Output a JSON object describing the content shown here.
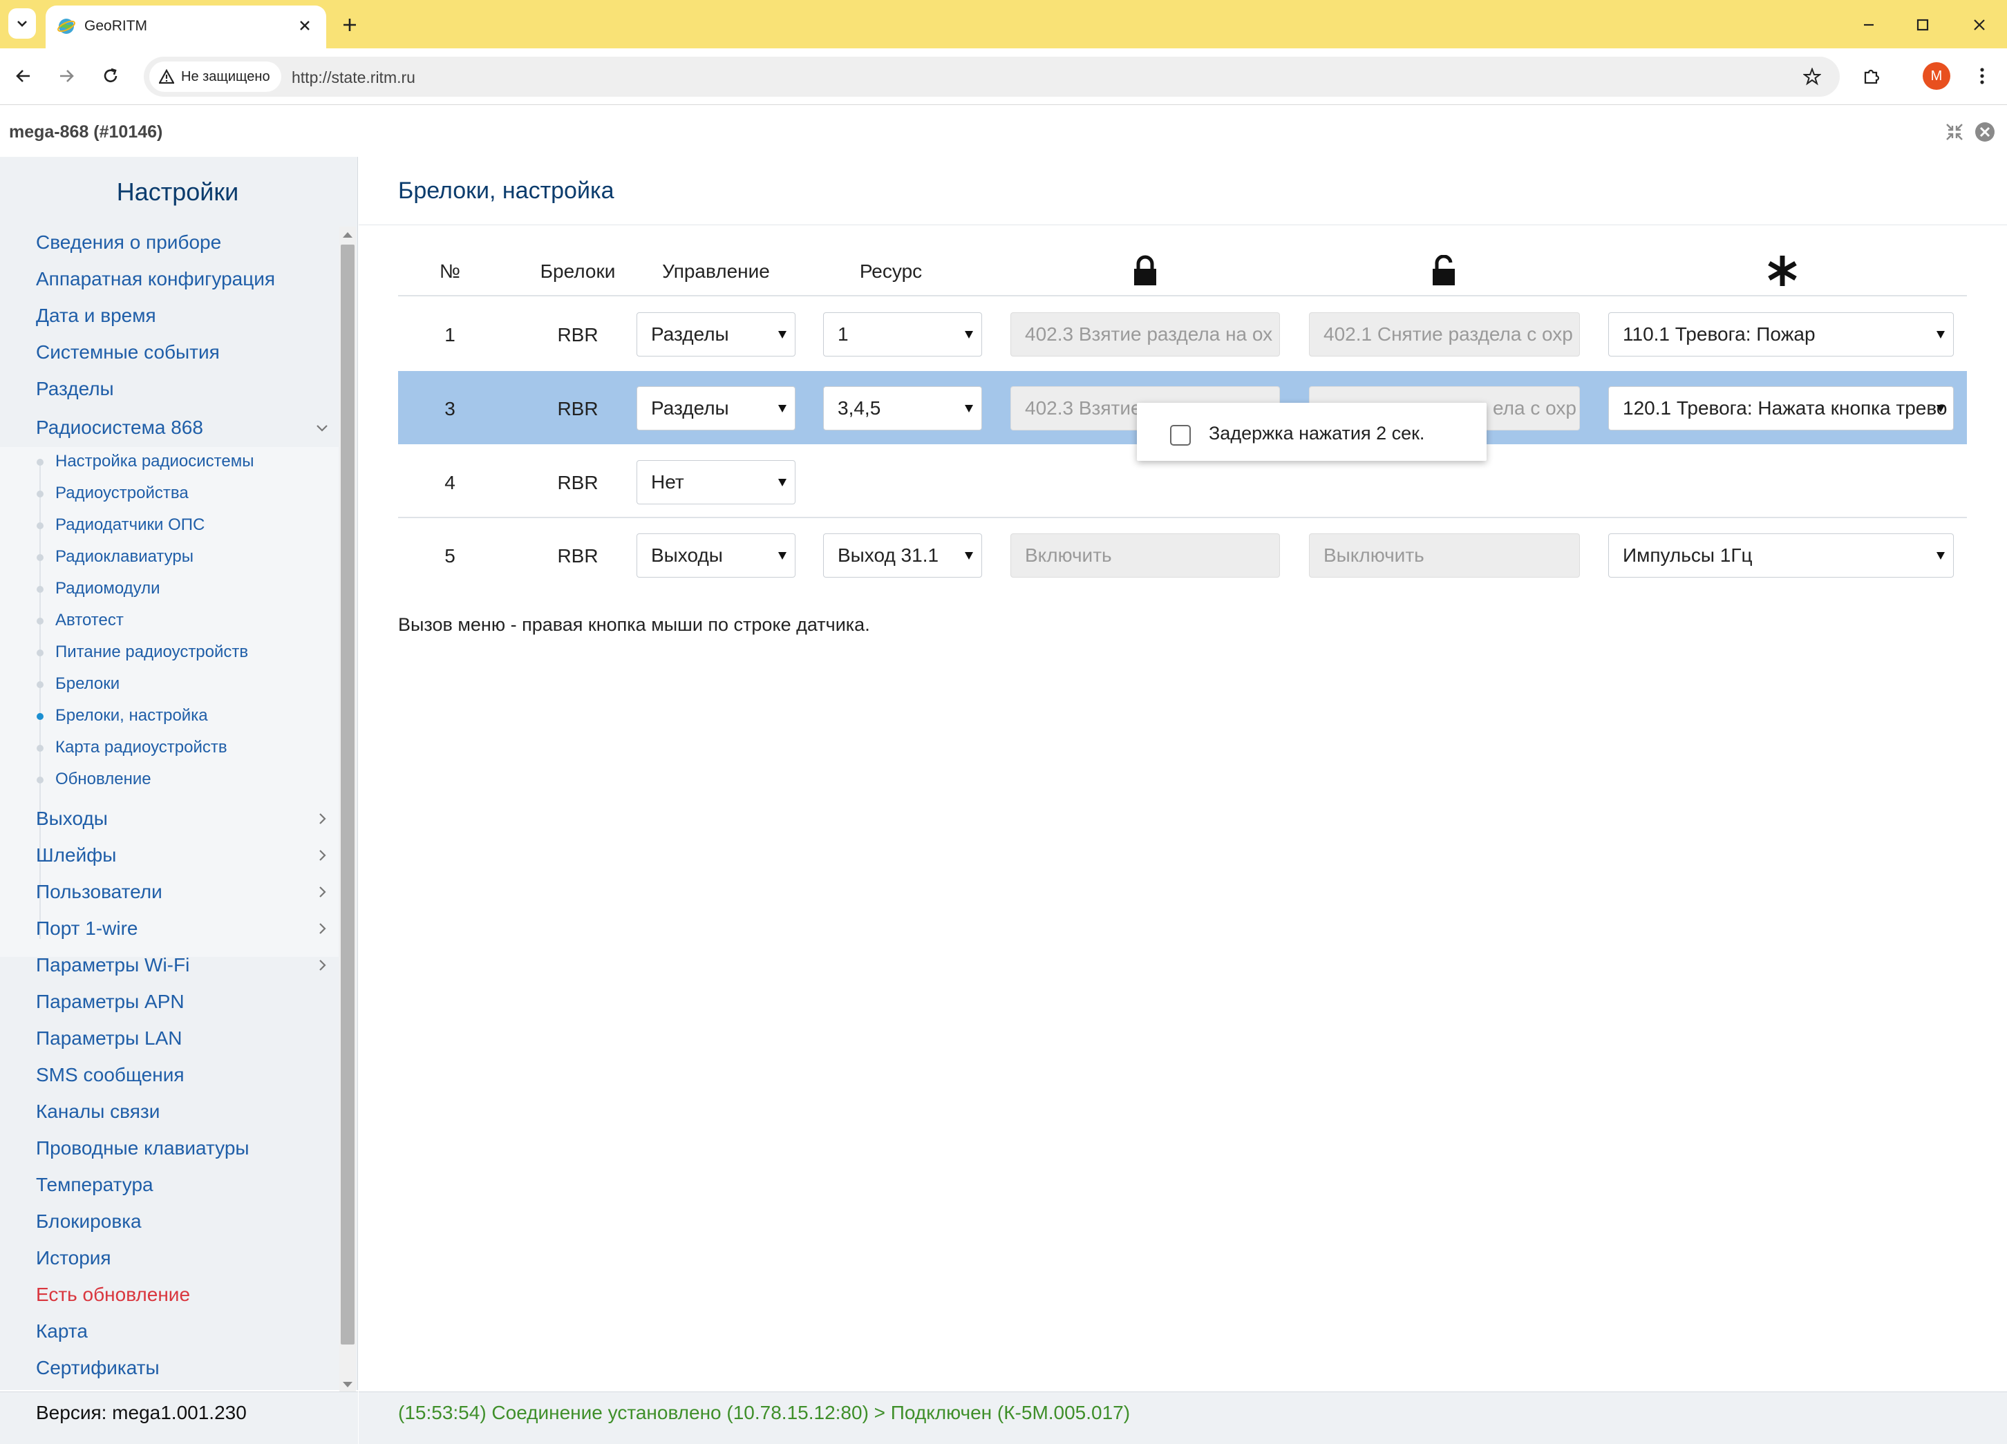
{
  "browser": {
    "tab_title": "GeoRITM",
    "security_label": "Не защищено",
    "url": "http://state.ritm.ru",
    "profile_initial": "M"
  },
  "header": {
    "device_title": "mega-868 (#10146)"
  },
  "sidebar": {
    "title": "Настройки",
    "items_top": [
      "Сведения о приборе",
      "Аппаратная конфигурация",
      "Дата и время",
      "Системные события",
      "Разделы"
    ],
    "radio_group": {
      "label": "Радиосистема 868",
      "subitems": [
        "Настройка радиосистемы",
        "Радиоустройства",
        "Радиодатчики ОПС",
        "Радиоклавиатуры",
        "Радиомодули",
        "Автотест",
        "Питание радиоустройств",
        "Брелоки",
        "Брелоки, настройка",
        "Карта радиоустройств",
        "Обновление"
      ],
      "active_subitem": "Брелоки, настройка"
    },
    "items_expandable": [
      "Выходы",
      "Шлейфы",
      "Пользователи",
      "Порт 1-wire",
      "Параметры Wi-Fi"
    ],
    "items_bottom": [
      "Параметры APN",
      "Параметры LAN",
      "SMS сообщения",
      "Каналы связи",
      "Проводные клавиатуры",
      "Температура",
      "Блокировка",
      "История"
    ],
    "update_item": "Есть обновление",
    "items_end": [
      "Карта",
      "Сертификаты"
    ],
    "version": "Версия: mega1.001.230"
  },
  "main": {
    "title": "Брелоки, настройка",
    "columns": {
      "num": "№",
      "fob": "Брелоки",
      "control": "Управление",
      "resource": "Ресурс",
      "lock_icon": "lock-icon",
      "unlock_icon": "unlock-icon",
      "star_icon": "asterisk-icon"
    },
    "rows": [
      {
        "num": "1",
        "fob": "RBR",
        "control": "Разделы",
        "resource": "1",
        "lock": "402.3 Взятие раздела на ох",
        "unlock": "402.1 Снятие раздела с охр",
        "star": "110.1 Тревога: Пожар"
      },
      {
        "num": "3",
        "fob": "RBR",
        "control": "Разделы",
        "resource": "3,4,5",
        "lock": "402.3 Взятие",
        "unlock_tail": "ела с охр",
        "star": "120.1 Тревога: Нажата кнопка трево"
      },
      {
        "num": "4",
        "fob": "RBR",
        "control": "Нет"
      },
      {
        "num": "5",
        "fob": "RBR",
        "control": "Выходы",
        "resource": "Выход 31.1",
        "lock": "Включить",
        "unlock": "Выключить",
        "star": "Импульсы 1Гц"
      }
    ],
    "selected_row": 2,
    "context_menu": {
      "checkbox_label": "Задержка нажатия 2 сек.",
      "checked": false
    },
    "hint": "Вызов меню - правая кнопка мыши по строке датчика."
  },
  "status": {
    "text": "(15:53:54) Соединение установлено (10.78.15.12:80) > Подключен (К-5М.005.017)"
  },
  "colors": {
    "tabbar": "#f9e276",
    "link": "#1f5ea8",
    "title": "#0b3c6d",
    "alert": "#d9363e",
    "row_highlight": "#a4c6ea",
    "status_ok": "#3f8f2a"
  }
}
